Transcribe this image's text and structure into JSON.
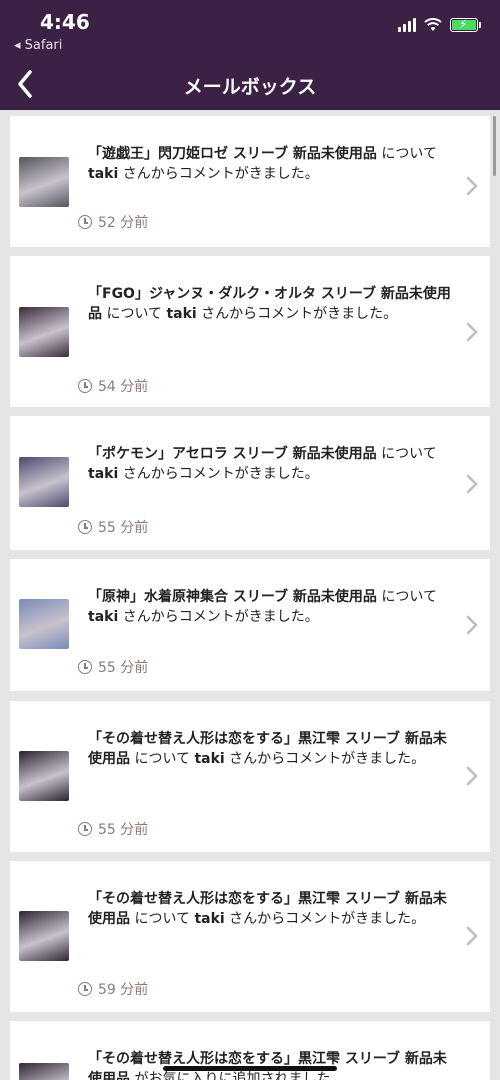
{
  "status": {
    "time": "4:46",
    "back_app": "◂ Safari"
  },
  "nav": {
    "title": "メールボックス"
  },
  "items": [
    {
      "title": "「遊戯王」閃刀姫ロゼ スリーブ 新品未使用品",
      "about": " について ",
      "user": "taki",
      "tail": " さんからコメントがきました。",
      "time": "52 分前",
      "thumb_color": "#55565c"
    },
    {
      "title": "「FGO」ジャンヌ・ダルク・オルタ スリーブ 新品未使用品",
      "about": " について ",
      "user": "taki",
      "tail": " さんからコメントがきました。",
      "time": "54 分前",
      "thumb_color": "#3a2a3a"
    },
    {
      "title": "「ポケモン」アセロラ スリーブ 新品未使用品",
      "about": " について ",
      "user": "taki",
      "tail": " さんからコメントがきました。",
      "time": "55 分前",
      "thumb_color": "#4a4a70"
    },
    {
      "title": "「原神」水着原神集合 スリーブ 新品未使用品",
      "about": " について ",
      "user": "taki",
      "tail": " さんからコメントがきました。",
      "time": "55 分前",
      "thumb_color": "#7a8ab8"
    },
    {
      "title": "「その着せ替え人形は恋をする」黒江雫 スリーブ 新品未使用品",
      "about": " について ",
      "user": "taki",
      "tail": " さんからコメントがきました。",
      "time": "55 分前",
      "thumb_color": "#2a2430"
    },
    {
      "title": "「その着せ替え人形は恋をする」黒江雫 スリーブ 新品未使用品",
      "about": " について ",
      "user": "taki",
      "tail": " さんからコメントがきました。",
      "time": "59 分前",
      "thumb_color": "#2e2632"
    },
    {
      "title": "「その着せ替え人形は恋をする」黒江雫 スリーブ 新品未使用品",
      "about": " がお気に入りに追加されました",
      "user": "",
      "tail": "",
      "time": "",
      "thumb_color": "#302834"
    }
  ],
  "colors": {
    "header_bg": "#3b2244",
    "time_text": "#8c7b78",
    "page_bg": "#e5e5e5"
  }
}
